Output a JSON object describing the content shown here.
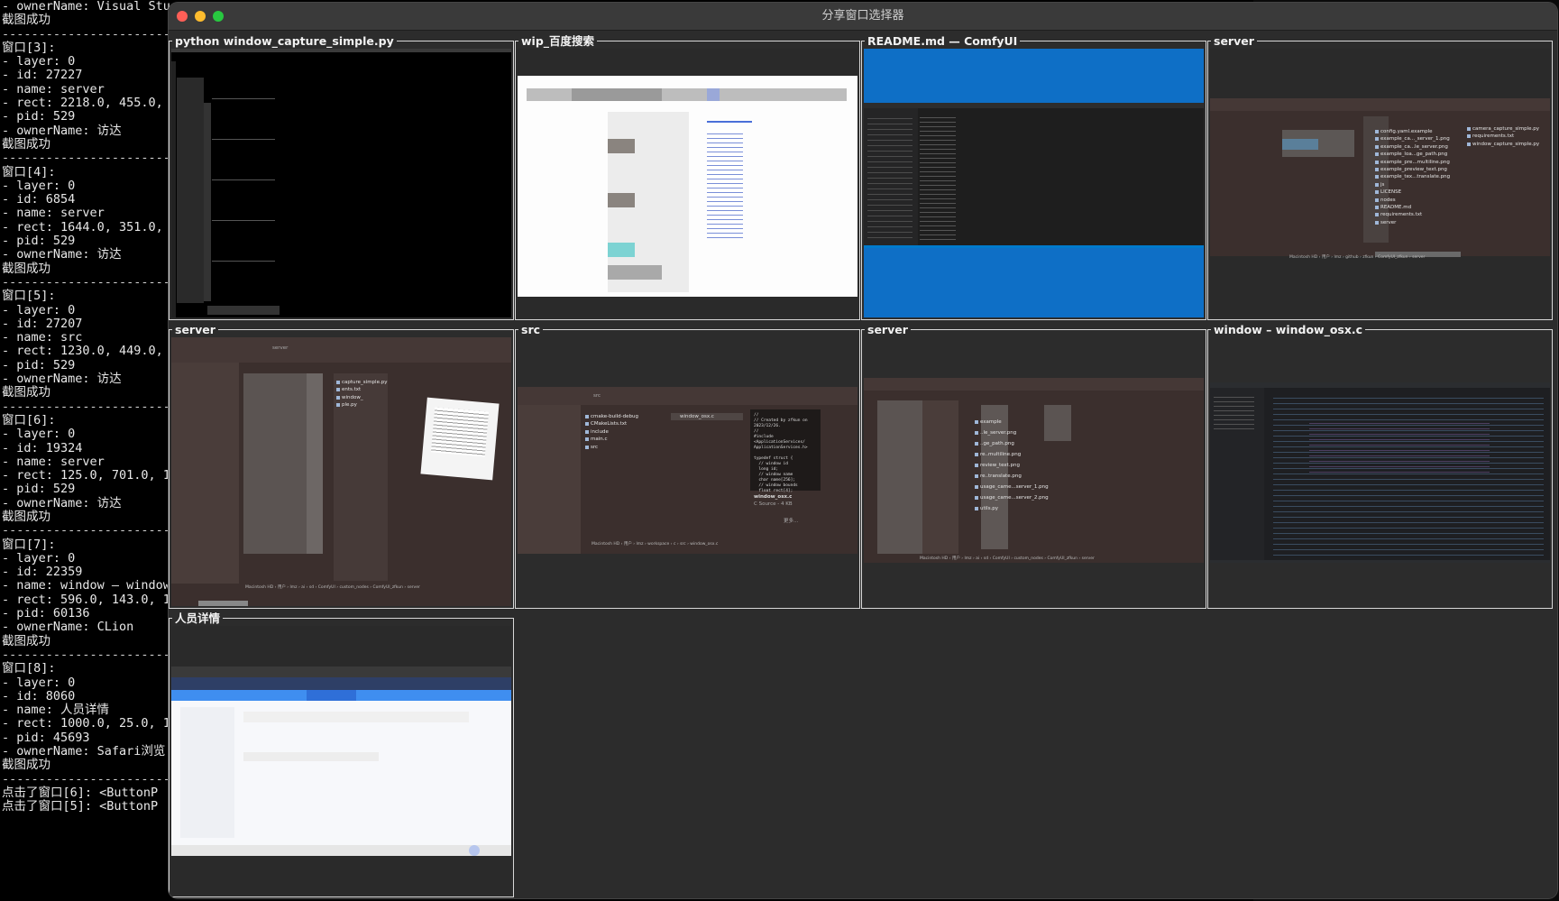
{
  "terminal": {
    "lines": [
      "- ownerName: Visual Studio Code",
      "截图成功",
      "-------------------------",
      "窗口[3]:",
      "- layer: 0",
      "- id: 27227",
      "- name: server",
      "- rect: 2218.0, 455.0,",
      "- pid: 529",
      "- ownerName: 访达",
      "截图成功",
      "-------------------------",
      "窗口[4]:",
      "- layer: 0",
      "- id: 6854",
      "- name: server",
      "- rect: 1644.0, 351.0,",
      "- pid: 529",
      "- ownerName: 访达",
      "截图成功",
      "-------------------------",
      "窗口[5]:",
      "- layer: 0",
      "- id: 27207",
      "- name: src",
      "- rect: 1230.0, 449.0,",
      "- pid: 529",
      "- ownerName: 访达",
      "截图成功",
      "-------------------------",
      "窗口[6]:",
      "- layer: 0",
      "- id: 19324",
      "- name: server",
      "- rect: 125.0, 701.0, 1",
      "- pid: 529",
      "- ownerName: 访达",
      "截图成功",
      "-------------------------",
      "窗口[7]:",
      "- layer: 0",
      "- id: 22359",
      "- name: window — window",
      "- rect: 596.0, 143.0, 1",
      "- pid: 60136",
      "- ownerName: CLion",
      "截图成功",
      "-------------------------",
      "窗口[8]:",
      "- layer: 0",
      "- id: 8060",
      "- name: 人员详情",
      "- rect: 1000.0, 25.0, 1",
      "- pid: 45693",
      "- ownerName: Safari浏览",
      "截图成功",
      "-------------------------",
      "点击了窗口[6]: <ButtonP",
      "点击了窗口[5]: <ButtonP"
    ]
  },
  "window": {
    "title": "分享窗口选择器"
  },
  "tiles": [
    {
      "title": "python window_capture_simple.py"
    },
    {
      "title": "wip_百度搜索"
    },
    {
      "title": "README.md — ComfyUI"
    },
    {
      "title": "server"
    },
    {
      "title": "server"
    },
    {
      "title": "src"
    },
    {
      "title": "server"
    },
    {
      "title": "window – window_osx.c"
    },
    {
      "title": "人员详情"
    }
  ],
  "thumb_text": {
    "t4_files": [
      "config.yaml.example",
      "example_ca..._server_1.png",
      "example_ca...le_server.png",
      "example_loa...ge_path.png",
      "example_pre...multiline.png",
      "example_preview_text.png",
      "example_tex...translate.png",
      "js",
      "LICENSE",
      "nodes",
      "README.md",
      "requirements.txt",
      "server"
    ],
    "t4_right": [
      "camera_capture_simple.py",
      "requirements.txt",
      "window_capture_simple.py"
    ],
    "t4_path": "Macintosh HD › 用户 › lmz › github › zfkun › ComfyUI_zfkun › server",
    "t5_path": "Macintosh HD › 用户 › lmz › ai › sd › ComfyUI › custom_nodes › ComfyUI_zfkun › server",
    "t5_files": [
      "capture_simple.py",
      "ents.txt",
      "window_",
      "ple.py"
    ],
    "t6_folder": "src",
    "t6_tree": [
      "cmake-build-debug",
      "CMakeLists.txt",
      "include",
      "main.c",
      "src"
    ],
    "t6_file": "window_osx.c",
    "t6_code": "//\n// Created by zfkun on\n2023/12/26.\n//\n#include\n<ApplicationServices/\nApplicationServices.h>\n\ntypedef struct {\n  // window id\n  long id;\n  // window name\n  char name[256];\n  // window bounds\n  float rect[4];",
    "t6_info_name": "window_osx.c",
    "t6_info_type": "C Source - 4 KB",
    "t6_more": "更多...",
    "t6_path": "Macintosh HD › 用户 › lmz › workspace › c › src › window_osx.c",
    "t7_files": [
      "example",
      "..le_server.png",
      "..ge_path.png",
      "re..multiline.png",
      "review_text.png",
      "re..translate.png",
      "usage_came...server_1.png",
      "usage_came...server_2.png",
      "utils.py"
    ],
    "t7_path": "Macintosh HD › 用户 › lmz › ai › sd › ComfyUI › custom_nodes › ComfyUI_zfkun › server"
  },
  "colors": {
    "vscode_blue": "#0e6fc6",
    "finder_bg": "#3b2f2d",
    "folder_blue": "#3b9bef",
    "safari_blue": "#3f8ef0"
  }
}
